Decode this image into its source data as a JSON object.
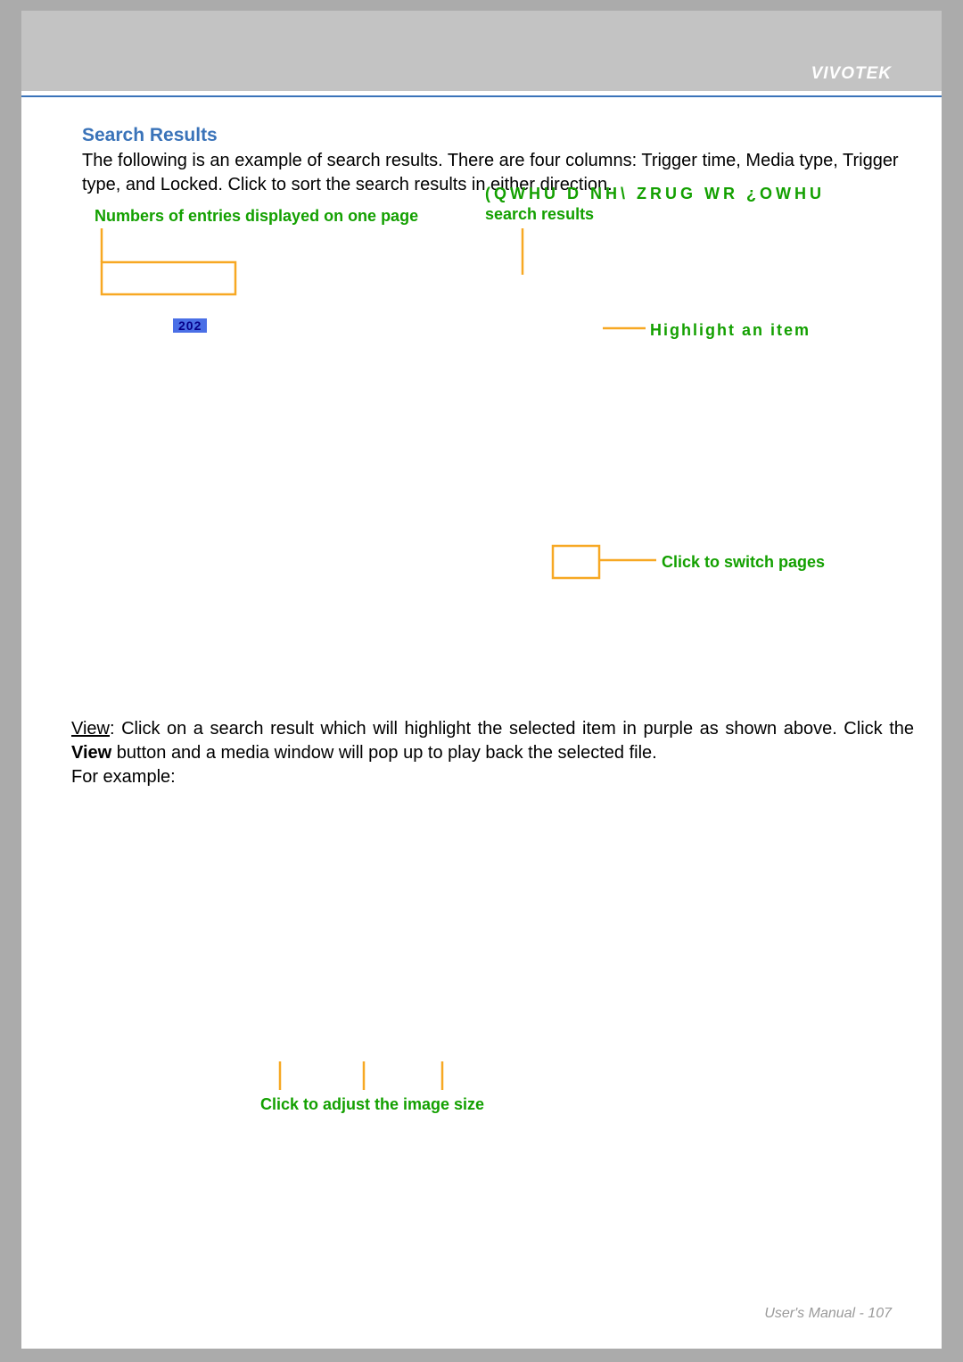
{
  "brand": "VIVOTEK",
  "section_title": "Search Results",
  "intro": "The following is an example of search results. There are four columns: Trigger time, Media type, Trigger type, and Locked. Click        to sort the search results in either direction.",
  "labels": {
    "entries": "Numbers of entries displayed on one page",
    "enter_key": "(QWHU  D  NH\\  ZRUG  WR  ¿OWHU",
    "search_results": "search results",
    "highlight": "Highlight an item",
    "switch_pages": "Click to switch pages",
    "adjust_size": "Click to adjust the image size"
  },
  "chip": "202",
  "view_para": {
    "lead": "View",
    "rest1": ": Click on a search result which will highlight the selected item in purple as shown above. Click the ",
    "bold1": "View",
    "rest2": " button and a media window will pop up to play back the selected file.",
    "line3": "For example:"
  },
  "footer_text": "User's Manual - 107"
}
